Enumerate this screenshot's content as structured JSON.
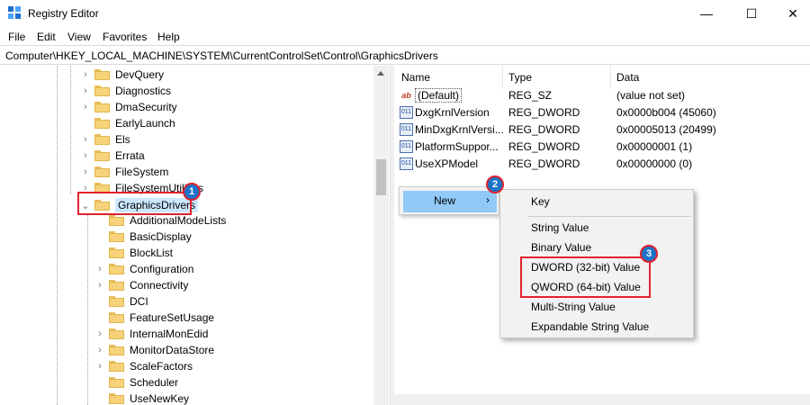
{
  "window": {
    "title": "Registry Editor",
    "minimize_glyph": "—",
    "maximize_glyph": "☐",
    "close_glyph": "✕"
  },
  "menu": [
    "File",
    "Edit",
    "View",
    "Favorites",
    "Help"
  ],
  "address": "Computer\\HKEY_LOCAL_MACHINE\\SYSTEM\\CurrentControlSet\\Control\\GraphicsDrivers",
  "tree": {
    "parent_items": [
      {
        "label": "DevQuery",
        "expandable": true
      },
      {
        "label": "Diagnostics",
        "expandable": true
      },
      {
        "label": "DmaSecurity",
        "expandable": true
      },
      {
        "label": "EarlyLaunch",
        "expandable": false
      },
      {
        "label": "Els",
        "expandable": true
      },
      {
        "label": "Errata",
        "expandable": true
      },
      {
        "label": "FileSystem",
        "expandable": true
      },
      {
        "label": "FileSystemUtilities",
        "expandable": true
      }
    ],
    "selected": {
      "label": "GraphicsDrivers",
      "expanded": true
    },
    "child_items": [
      {
        "label": "AdditionalModeLists",
        "expandable": false
      },
      {
        "label": "BasicDisplay",
        "expandable": false
      },
      {
        "label": "BlockList",
        "expandable": false
      },
      {
        "label": "Configuration",
        "expandable": true
      },
      {
        "label": "Connectivity",
        "expandable": true
      },
      {
        "label": "DCI",
        "expandable": false
      },
      {
        "label": "FeatureSetUsage",
        "expandable": false
      },
      {
        "label": "InternalMonEdid",
        "expandable": true
      },
      {
        "label": "MonitorDataStore",
        "expandable": true
      },
      {
        "label": "ScaleFactors",
        "expandable": true
      },
      {
        "label": "Scheduler",
        "expandable": false
      },
      {
        "label": "UseNewKey",
        "expandable": false
      }
    ]
  },
  "columns": {
    "name": "Name",
    "type": "Type",
    "data": "Data"
  },
  "values": [
    {
      "name": "(Default)",
      "type": "REG_SZ",
      "data": "(value not set)",
      "icon": "string-value-icon"
    },
    {
      "name": "DxgKrnlVersion",
      "type": "REG_DWORD",
      "data": "0x0000b004 (45060)",
      "icon": "binary-value-icon"
    },
    {
      "name": "MinDxgKrnlVersi...",
      "type": "REG_DWORD",
      "data": "0x00005013 (20499)",
      "icon": "binary-value-icon"
    },
    {
      "name": "PlatformSuppor...",
      "type": "REG_DWORD",
      "data": "0x00000001 (1)",
      "icon": "binary-value-icon"
    },
    {
      "name": "UseXPModel",
      "type": "REG_DWORD",
      "data": "0x00000000 (0)",
      "icon": "binary-value-icon"
    }
  ],
  "context_menu": {
    "new_label": "New",
    "arrow": "›"
  },
  "submenu": {
    "items": [
      "Key",
      "String Value",
      "Binary Value",
      "DWORD (32-bit) Value",
      "QWORD (64-bit) Value",
      "Multi-String Value",
      "Expandable String Value"
    ]
  },
  "badges": [
    "1",
    "2",
    "3"
  ],
  "colors": {
    "accent": "#1a73c7",
    "highlight": "#e0232e",
    "folder": "#f6d27a",
    "menu_hover": "#91c9f7"
  }
}
